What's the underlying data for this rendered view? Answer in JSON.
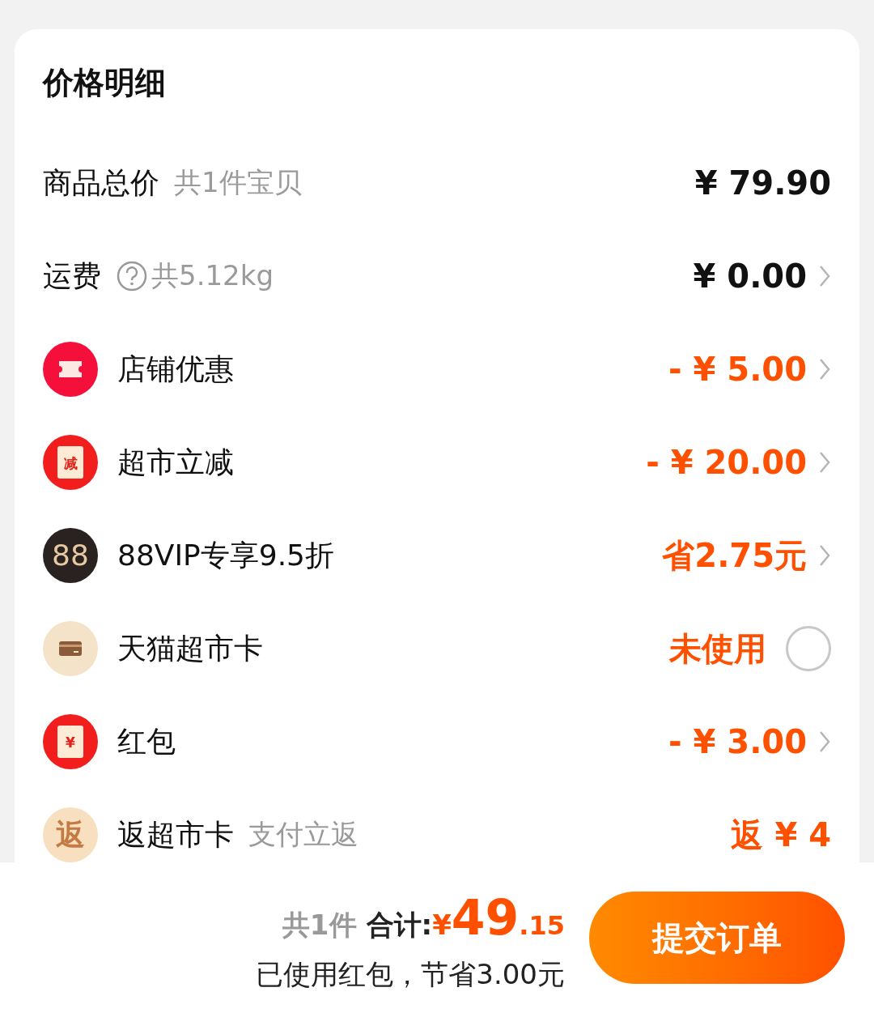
{
  "title": "价格明细",
  "rows": [
    {
      "kind": "plain",
      "label": "商品总价",
      "note": "共1件宝贝",
      "help": false,
      "value": "¥ 79.90",
      "accent": false,
      "chevron": false
    },
    {
      "kind": "plain",
      "label": "运费",
      "note": "共5.12kg",
      "help": true,
      "value": "¥ 0.00",
      "accent": false,
      "chevron": true
    },
    {
      "kind": "icon",
      "label": "店铺优惠",
      "value": "- ¥ 5.00",
      "accent": true,
      "chevron": true
    },
    {
      "kind": "icon",
      "glyph": "减",
      "label": "超市立减",
      "value": "- ¥ 20.00",
      "accent": true,
      "chevron": true
    },
    {
      "kind": "icon",
      "glyph": "88",
      "label": "88VIP专享9.5折",
      "value": "省2.75元",
      "accent": true,
      "chevron": true
    },
    {
      "kind": "toggle",
      "label": "天猫超市卡",
      "value": "未使用",
      "accent": true,
      "checked": false
    },
    {
      "kind": "icon",
      "glyph": "¥",
      "label": "红包",
      "value": "- ¥ 3.00",
      "accent": true,
      "chevron": true
    },
    {
      "kind": "icon",
      "glyph": "返",
      "label": "返超市卡",
      "note": "支付立返",
      "value": "返 ¥ 4",
      "accent": true,
      "chevron": false
    }
  ],
  "footer": {
    "count": "共1件",
    "total_label": "合计:",
    "currency": "¥",
    "integer": "49",
    "decimal": ".15",
    "saving": "已使用红包，节省3.00元",
    "submit": "提交订单"
  }
}
